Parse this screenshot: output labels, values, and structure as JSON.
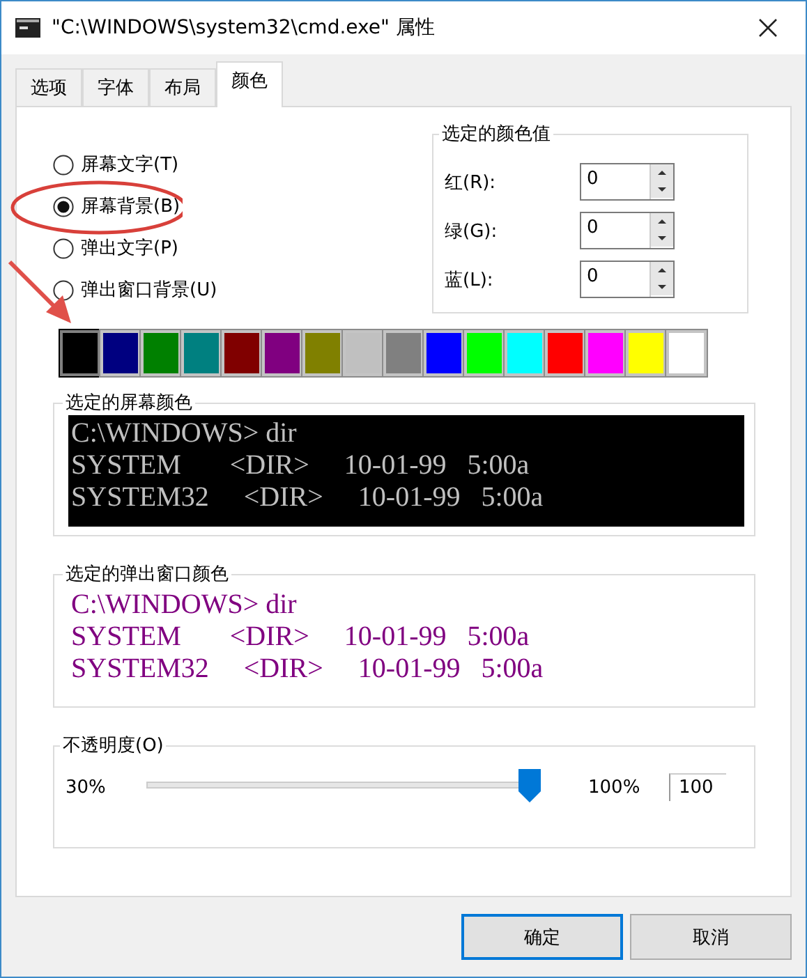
{
  "window": {
    "title": "\"C:\\WINDOWS\\system32\\cmd.exe\" 属性"
  },
  "tabs": [
    {
      "label": "选项",
      "selected": false
    },
    {
      "label": "字体",
      "selected": false
    },
    {
      "label": "布局",
      "selected": false
    },
    {
      "label": "颜色",
      "selected": true
    }
  ],
  "color_targets": [
    {
      "label": "屏幕文字(T)",
      "selected": false
    },
    {
      "label": "屏幕背景(B)",
      "selected": true
    },
    {
      "label": "弹出文字(P)",
      "selected": false
    },
    {
      "label": "弹出窗口背景(U)",
      "selected": false
    }
  ],
  "color_values": {
    "title": "选定的颜色值",
    "fields": [
      {
        "label": "红(R):",
        "value": "0"
      },
      {
        "label": "绿(G):",
        "value": "0"
      },
      {
        "label": "蓝(L):",
        "value": "0"
      }
    ]
  },
  "palette": [
    {
      "color": "#000000",
      "selected": true
    },
    {
      "color": "#000080",
      "selected": false
    },
    {
      "color": "#008000",
      "selected": false
    },
    {
      "color": "#008080",
      "selected": false
    },
    {
      "color": "#800000",
      "selected": false
    },
    {
      "color": "#800080",
      "selected": false
    },
    {
      "color": "#808000",
      "selected": false
    },
    {
      "color": "#c0c0c0",
      "selected": false
    },
    {
      "color": "#808080",
      "selected": false
    },
    {
      "color": "#0000ff",
      "selected": false
    },
    {
      "color": "#00ff00",
      "selected": false
    },
    {
      "color": "#00ffff",
      "selected": false
    },
    {
      "color": "#ff0000",
      "selected": false
    },
    {
      "color": "#ff00ff",
      "selected": false
    },
    {
      "color": "#ffff00",
      "selected": false
    },
    {
      "color": "#ffffff",
      "selected": false
    }
  ],
  "screen_colors": {
    "title": "选定的屏幕颜色",
    "lines": [
      "C:\\WINDOWS> dir",
      "SYSTEM       <DIR>     10-01-99   5:00a",
      "SYSTEM32     <DIR>     10-01-99   5:00a"
    ]
  },
  "popup_colors": {
    "title": "选定的弹出窗口颜色",
    "lines": [
      "C:\\WINDOWS> dir",
      "SYSTEM       <DIR>     10-01-99   5:00a",
      "SYSTEM32     <DIR>     10-01-99   5:00a"
    ]
  },
  "opacity": {
    "label": "不透明度(O)",
    "min_label": "30%",
    "max_label": "100%",
    "level": 1,
    "value": "100"
  },
  "buttons": [
    {
      "label": "确定",
      "default": true
    },
    {
      "label": "取消",
      "default": false
    }
  ]
}
